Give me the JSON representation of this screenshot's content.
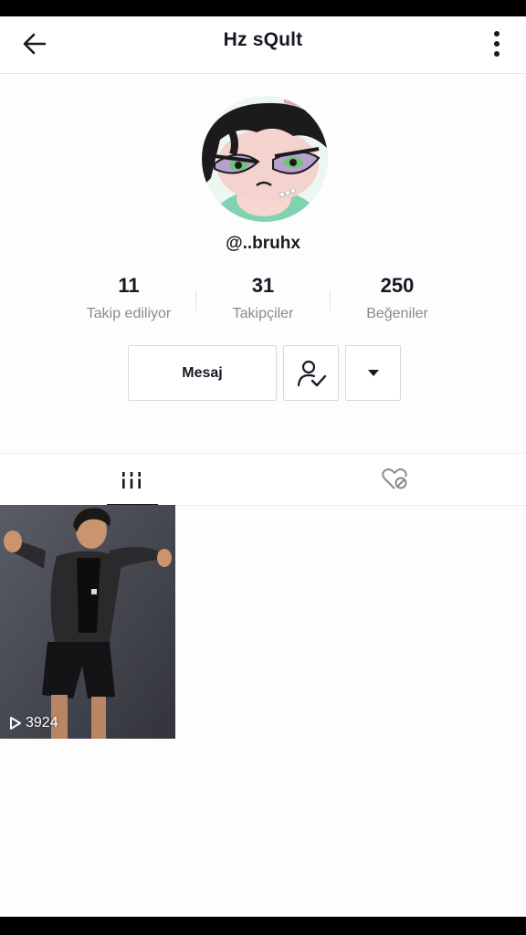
{
  "header": {
    "title": "Hz sQult"
  },
  "profile": {
    "username": "@..bruhx"
  },
  "stats": [
    {
      "value": "11",
      "label": "Takip ediliyor"
    },
    {
      "value": "31",
      "label": "Takipçiler"
    },
    {
      "value": "250",
      "label": "Beğeniler"
    }
  ],
  "actions": {
    "message_label": "Mesaj"
  },
  "videos": [
    {
      "views": "3924"
    }
  ]
}
